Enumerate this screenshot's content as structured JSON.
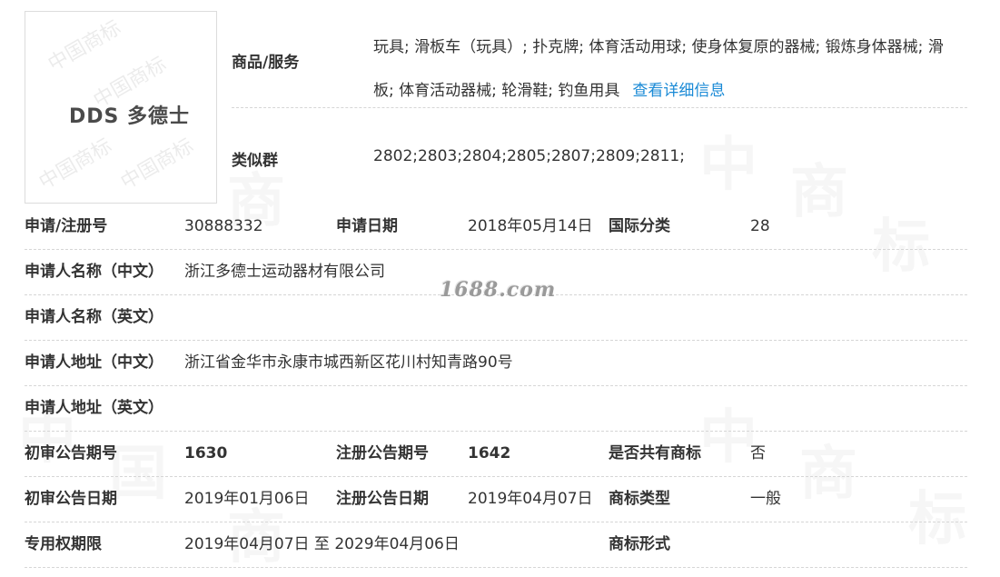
{
  "logo": {
    "text": "DDS 多德士"
  },
  "goods": {
    "label": "商品/服务",
    "text": "玩具; 滑板车（玩具）; 扑克牌; 体育活动用球; 使身体复原的器械; 锻炼身体器械; 滑板; 体育活动器械; 轮滑鞋; 钓鱼用具",
    "link": "查看详细信息"
  },
  "similar": {
    "label": "类似群",
    "value": "2802;2803;2804;2805;2807;2809;2811;"
  },
  "rows": [
    {
      "l1": "申请/注册号",
      "v1": "30888332",
      "l2": "申请日期",
      "v2": "2018年05月14日",
      "l3": "国际分类",
      "v3": "28"
    },
    {
      "l1": "申请人名称（中文）",
      "v1": "浙江多德士运动器材有限公司"
    },
    {
      "l1": "申请人名称（英文）",
      "v1": ""
    },
    {
      "l1": "申请人地址（中文）",
      "v1": "浙江省金华市永康市城西新区花川村知青路90号"
    },
    {
      "l1": "申请人地址（英文）",
      "v1": ""
    },
    {
      "l1": "初审公告期号",
      "v1": "1630",
      "l2": "注册公告期号",
      "v2": "1642",
      "l3": "是否共有商标",
      "v3": "否"
    },
    {
      "l1": "初审公告日期",
      "v1": "2019年01月06日",
      "l2": "注册公告日期",
      "v2": "2019年04月07日",
      "l3": "商标类型",
      "v3": "一般"
    },
    {
      "l1": "专用权期限",
      "v1": "2019年04月07日 至 2029年04月06日",
      "l3": "商标形式",
      "v3": ""
    }
  ],
  "watermark": "1688.com",
  "colors": {
    "link": "#1a8ad6",
    "text": "#333333",
    "divider": "#d6d6d6"
  }
}
